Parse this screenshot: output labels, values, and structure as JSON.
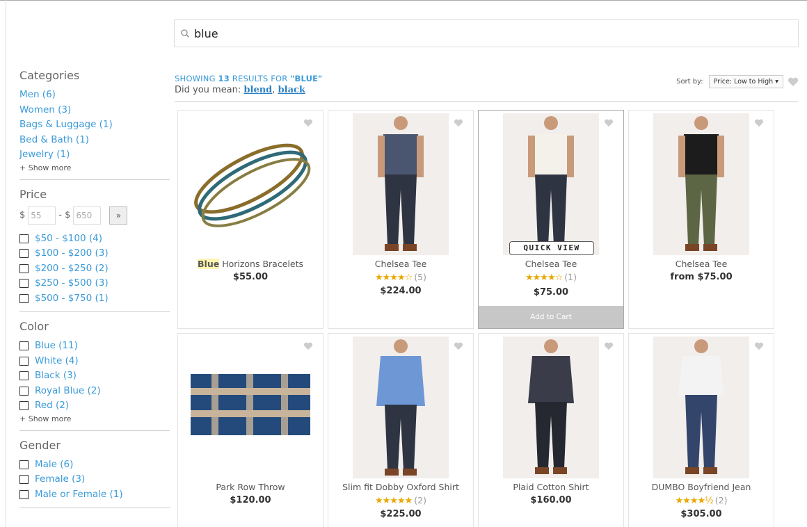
{
  "search": {
    "value": "blue"
  },
  "sidebar": {
    "categories": {
      "title": "Categories",
      "items": [
        "Men (6)",
        "Women (3)",
        "Bags & Luggage (1)",
        "Bed & Bath (1)",
        "Jewelry (1)"
      ],
      "show_more": "+ Show more"
    },
    "price": {
      "title": "Price",
      "min_prefix": "$",
      "min_value": "55",
      "sep": "- $",
      "max_value": "650",
      "go": "»",
      "ranges": [
        "$50 - $100 (4)",
        "$100 - $200 (3)",
        "$200 - $250 (2)",
        "$250 - $500 (3)",
        "$500 - $750 (1)"
      ]
    },
    "color": {
      "title": "Color",
      "items": [
        "Blue (11)",
        "White (4)",
        "Black (3)",
        "Royal Blue (2)",
        "Red (2)"
      ],
      "show_more": "+ Show more"
    },
    "gender": {
      "title": "Gender",
      "items": [
        "Male (6)",
        "Female (3)",
        "Male or Female (1)"
      ]
    }
  },
  "results": {
    "showing_prefix": "SHOWING",
    "count": "13",
    "showing_middle": "RESULTS FOR",
    "query": "\"BLUE\"",
    "did_you_mean": "Did you mean:",
    "suggest1": "blend",
    "suggest_sep": ",",
    "suggest2": "black"
  },
  "sort": {
    "label": "Sort by:",
    "value": "Price: Low to High ▾"
  },
  "products": [
    {
      "name_hl": "Blue",
      "name": " Horizons Bracelets",
      "price": "$55.00"
    },
    {
      "name": "Chelsea Tee",
      "stars": "★★★★☆",
      "count": "(5)",
      "price": "$224.00"
    },
    {
      "name": "Chelsea Tee",
      "stars": "★★★★☆",
      "count": "(1)",
      "price": "$75.00",
      "quick_view": "QUICK VIEW",
      "add_to_cart": "Add to Cart"
    },
    {
      "name": "Chelsea Tee",
      "price": "from $75.00"
    },
    {
      "name": "Park Row Throw",
      "price": "$120.00"
    },
    {
      "name": "Slim fit Dobby Oxford Shirt",
      "stars": "★★★★★",
      "count": "(2)",
      "price": "$225.00"
    },
    {
      "name": "Plaid Cotton Shirt",
      "price": "$160.00"
    },
    {
      "name": "DUMBO Boyfriend Jean",
      "stars": "★★★★½",
      "count": "(2)",
      "price": "$305.00"
    }
  ],
  "colors": {
    "link": "#3a9ad9",
    "star": "#e8a800",
    "highlight": "#fff6b0"
  }
}
